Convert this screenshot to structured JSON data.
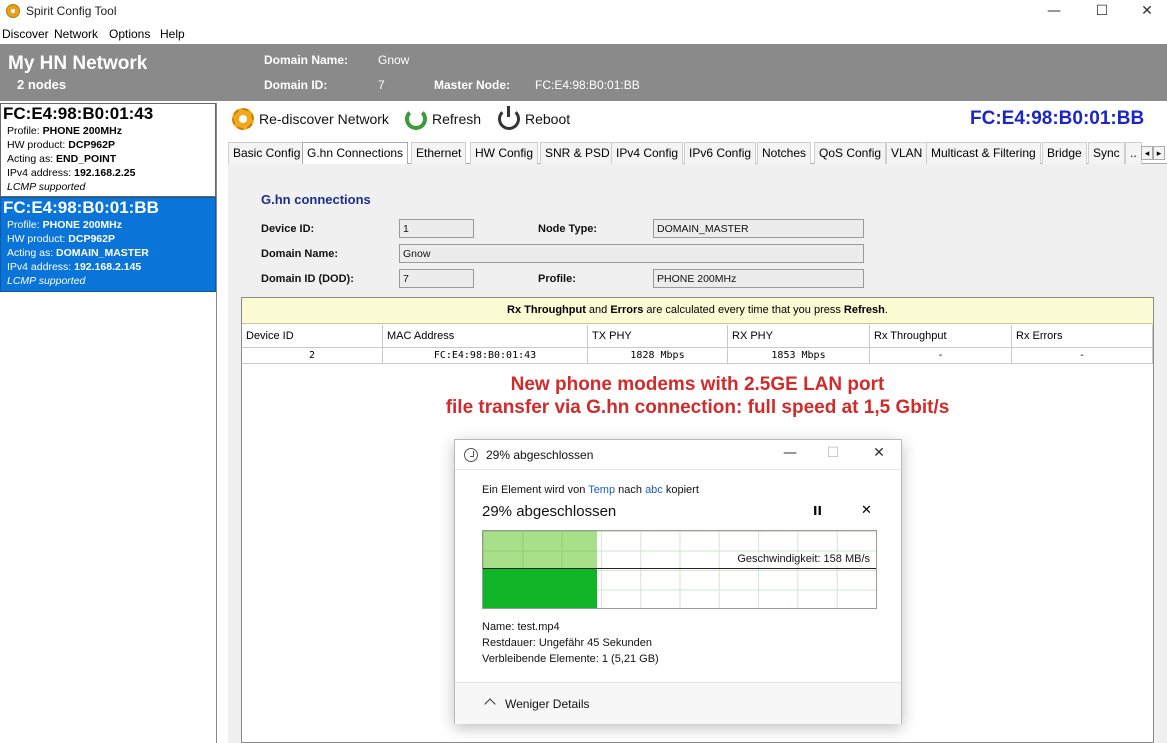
{
  "window": {
    "title": "Spirit Config Tool",
    "minimize": "—",
    "maximize": "☐",
    "close": "✕"
  },
  "menu": [
    "Discover",
    "Network",
    "Options",
    "Help"
  ],
  "header": {
    "network_title": "My HN Network",
    "node_count": "2 nodes",
    "domain_name_label": "Domain Name:",
    "domain_name_value": "Gnow",
    "domain_id_label": "Domain ID:",
    "domain_id_value": "7",
    "master_node_label": "Master Node:",
    "master_node_value": "FC:E4:98:B0:01:BB"
  },
  "nodes": [
    {
      "mac": "FC:E4:98:B0:01:43",
      "profile_label": "Profile:",
      "profile": "PHONE 200MHz",
      "hw_label": "HW product:",
      "hw": "DCP962P",
      "acting_label": "Acting as:",
      "acting": "END_POINT",
      "ip_label": "IPv4 address:",
      "ip": "192.168.2.25",
      "lcmp": "LCMP supported"
    },
    {
      "mac": "FC:E4:98:B0:01:BB",
      "profile_label": "Profile:",
      "profile": "PHONE 200MHz",
      "hw_label": "HW product:",
      "hw": "DCP962P",
      "acting_label": "Acting as:",
      "acting": "DOMAIN_MASTER",
      "ip_label": "IPv4 address:",
      "ip": "192.168.2.145",
      "lcmp": "LCMP supported"
    }
  ],
  "toolbar": {
    "rediscover": "Re-discover Network",
    "refresh": "Refresh",
    "reboot": "Reboot",
    "selected_mac": "FC:E4:98:B0:01:BB"
  },
  "tabs": [
    "Basic Config",
    "G.hn Connections",
    "Ethernet",
    "HW Config",
    "SNR & PSD",
    "IPv4 Config",
    "IPv6 Config",
    "Notches",
    "QoS Config",
    "VLAN",
    "Multicast & Filtering",
    "Bridge",
    "Sync",
    ".."
  ],
  "tab_scroll": {
    "left": "◂",
    "right": "▸"
  },
  "ghn": {
    "section_title": "G.hn connections",
    "device_id_label": "Device ID:",
    "device_id": "1",
    "node_type_label": "Node Type:",
    "node_type": "DOMAIN_MASTER",
    "domain_name_label": "Domain Name:",
    "domain_name": "Gnow",
    "domain_id_label": "Domain ID (DOD):",
    "domain_id": "7",
    "profile_label": "Profile:",
    "profile": "PHONE 200MHz"
  },
  "table": {
    "notice_b1": "Rx Throughput",
    "notice_t1": " and ",
    "notice_b2": "Errors",
    "notice_t2": " are calculated every time that you press ",
    "notice_b3": "Refresh",
    "notice_t3": ".",
    "headers": [
      "Device ID",
      "MAC Address",
      "TX PHY",
      "RX PHY",
      "Rx Throughput",
      "Rx Errors"
    ],
    "rows": [
      [
        "2",
        "FC:E4:98:B0:01:43",
        "1828 Mbps",
        "1853 Mbps",
        "-",
        "-"
      ]
    ]
  },
  "annotation": {
    "line1": "New phone modems with 2.5GE LAN port",
    "line2": "file transfer via G.hn connection: full speed at 1,5 Gbit/s"
  },
  "copy_dialog": {
    "title": "29% abgeschlossen",
    "desc_pre": "Ein Element wird von ",
    "source": "Temp",
    "desc_mid": " nach ",
    "dest": "abc",
    "desc_post": " kopiert",
    "percent_text": "29% abgeschlossen",
    "progress_fraction": 0.29,
    "pause": "II",
    "cancel": "✕",
    "speed": "Geschwindigkeit: 158 MB/s",
    "name_line": "Name:  test.mp4",
    "remaining_time": "Restdauer:  Ungefähr 45 Sekunden",
    "remaining_items": "Verbleibende Elemente:  1 (5,21 GB)",
    "fewer_details": "Weniger Details",
    "ctl_min": "—",
    "ctl_max": "☐",
    "ctl_close": "✕"
  }
}
